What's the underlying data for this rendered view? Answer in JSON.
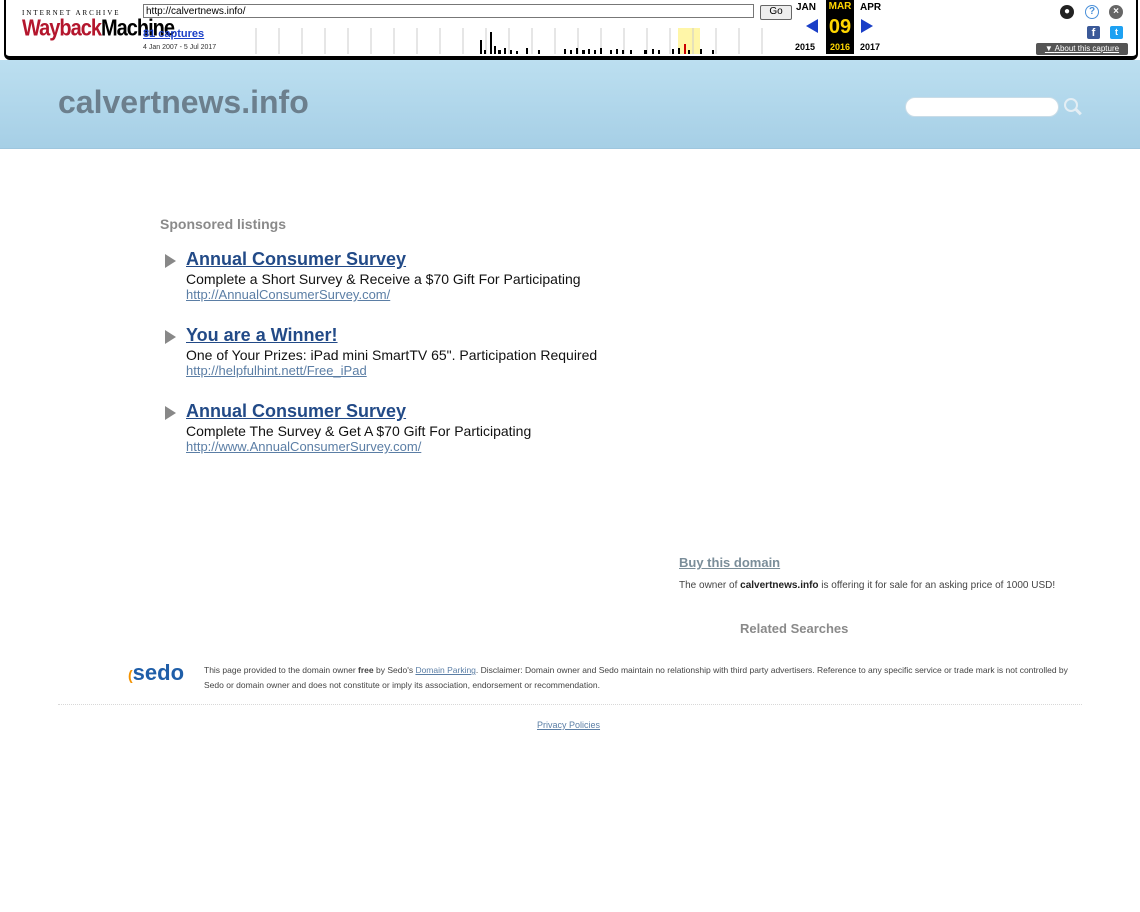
{
  "wayback": {
    "logo_top": "INTERNET ARCHIVE",
    "logo_way": "Wayback",
    "logo_machine": "Machine",
    "url": "http://calvertnews.info/",
    "go_label": "Go",
    "captures": "81 captures",
    "date_range": "4 Jan 2007 - 5 Jul 2017",
    "month_prev": "JAN",
    "month_cur": "MAR",
    "month_next": "APR",
    "day": "09",
    "year_prev": "2015",
    "year_cur": "2016",
    "year_next": "2017",
    "about": "About this capture",
    "icons": [
      "user-icon",
      "help-icon",
      "close-icon",
      "facebook-icon",
      "twitter-icon"
    ]
  },
  "header": {
    "site_title": "calvertnews.info",
    "search_placeholder": ""
  },
  "listings": {
    "heading": "Sponsored listings",
    "items": [
      {
        "title": "Annual Consumer Survey",
        "desc": "Complete a Short Survey & Receive a $70 Gift For Participating",
        "url": "http://AnnualConsumerSurvey.com/"
      },
      {
        "title": "You are a Winner!",
        "desc": "One of Your Prizes: iPad mini SmartTV 65\". Participation Required",
        "url": "http://helpfulhint.nett/Free_iPad"
      },
      {
        "title": "Annual Consumer Survey",
        "desc": "Complete The Survey & Get A $70 Gift For Participating",
        "url": "http://www.AnnualConsumerSurvey.com/"
      }
    ]
  },
  "domain_sale": {
    "buy": "Buy this domain",
    "owner_pre": "The owner of ",
    "owner_domain": "calvertnews.info",
    "owner_post": " is offering it for sale for an asking price of 1000 USD!"
  },
  "related": "Related Searches",
  "footer": {
    "sedo": "sedo",
    "disc_pre": "This page provided to the domain owner ",
    "disc_free": "free",
    "disc_by": " by Sedo's ",
    "disc_link": "Domain Parking",
    "disc_post": ". Disclaimer: Domain owner and Sedo maintain no relationship with third party advertisers. Reference to any specific service or trade mark is not controlled by Sedo or domain owner and does not constitute or imply its association, endorsement or recommendation.",
    "privacy": "Privacy Policies"
  }
}
